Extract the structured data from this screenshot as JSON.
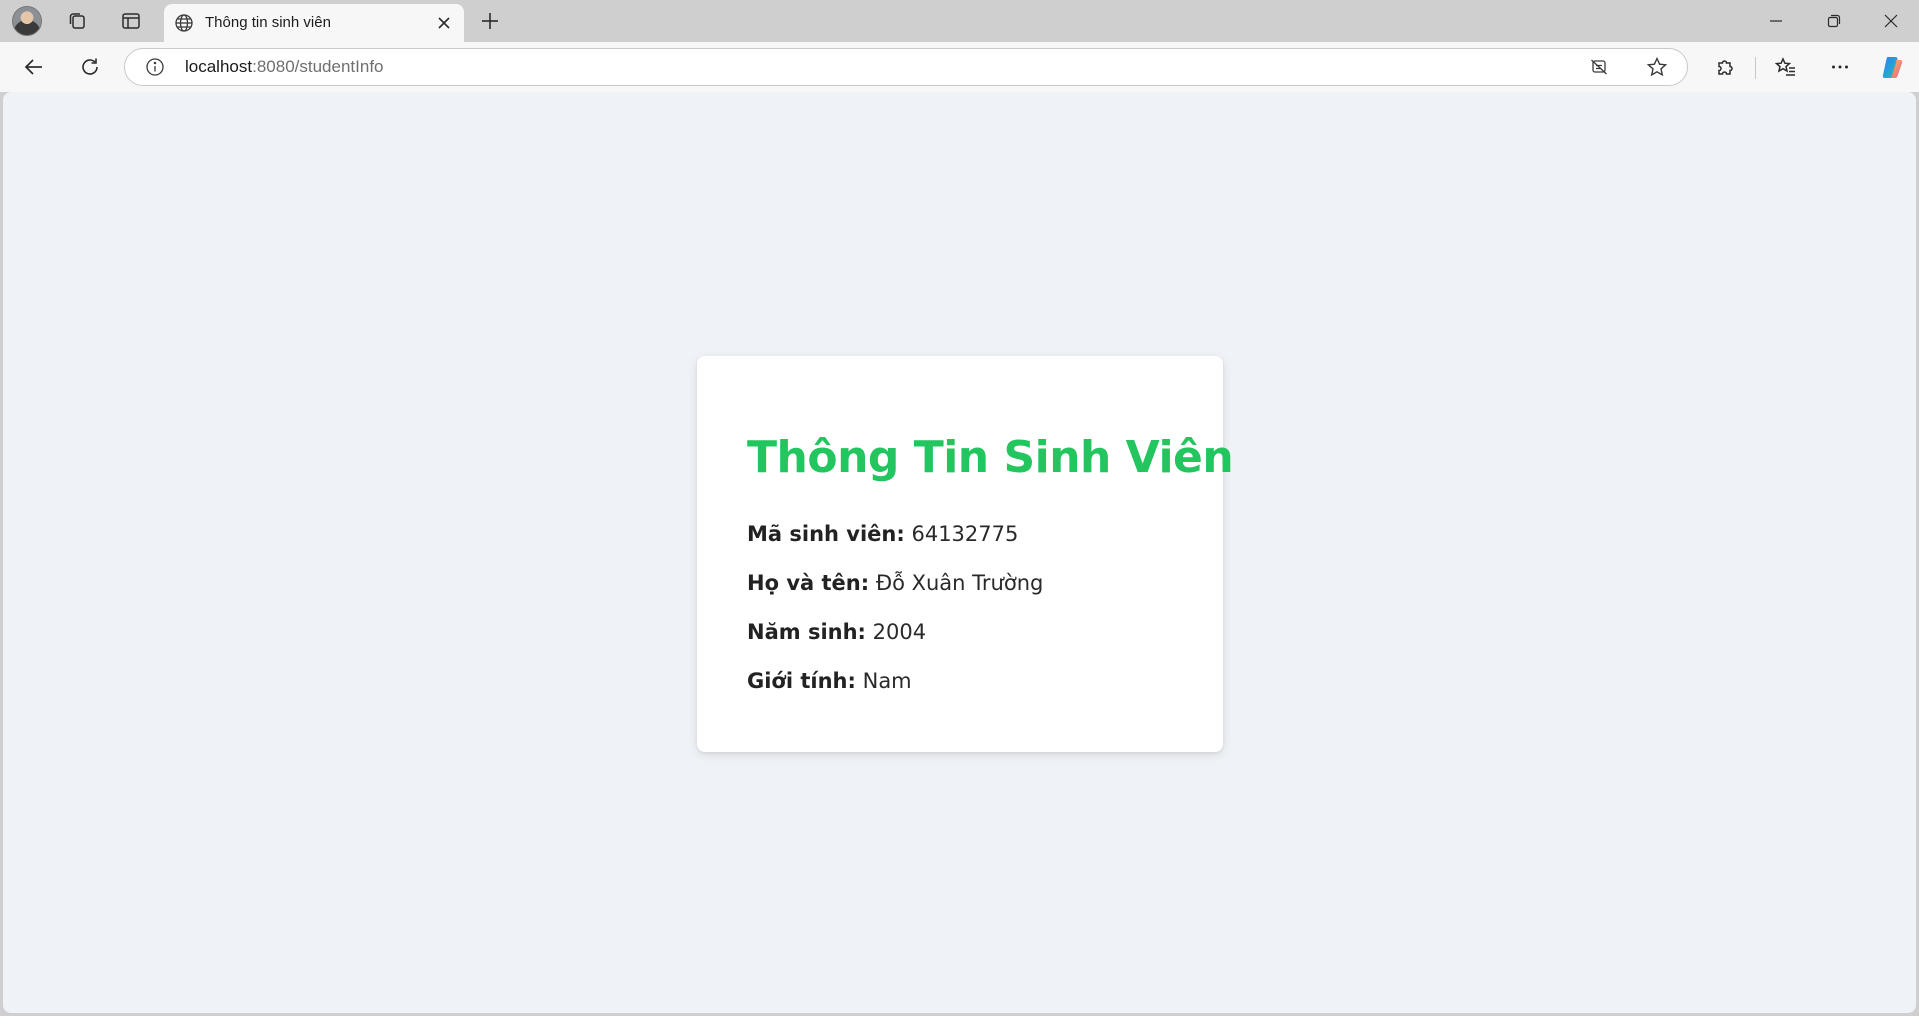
{
  "browser": {
    "tab": {
      "title": "Thông tin sinh viên",
      "icon": "globe-icon"
    },
    "address_bar": {
      "host": "localhost",
      "port_path": ":8080/studentInfo"
    },
    "icons": {
      "collections": "collections-icon",
      "vertical_tabs": "vertical-tabs-icon",
      "close_tab": "close-icon",
      "new_tab": "plus-icon",
      "minimize": "minimize-icon",
      "restore": "restore-icon",
      "close_window": "close-icon",
      "back": "back-arrow-icon",
      "refresh": "refresh-icon",
      "site_info": "info-icon",
      "tracking": "tracking-prevention-icon",
      "favorite": "star-icon",
      "extensions": "puzzle-icon",
      "favorites_list": "favorites-icon",
      "more": "more-icon",
      "copilot": "copilot-icon"
    }
  },
  "page": {
    "title": "Thông Tin Sinh Viên",
    "fields": [
      {
        "label": "Mã sinh viên:",
        "value": "64132775"
      },
      {
        "label": "Họ và tên:",
        "value": "Đỗ Xuân Trường"
      },
      {
        "label": "Năm sinh:",
        "value": "2004"
      },
      {
        "label": "Giới tính:",
        "value": "Nam"
      }
    ]
  },
  "colors": {
    "title_green": "#22c55e",
    "page_background": "#eff2f6",
    "card_background": "#ffffff"
  }
}
